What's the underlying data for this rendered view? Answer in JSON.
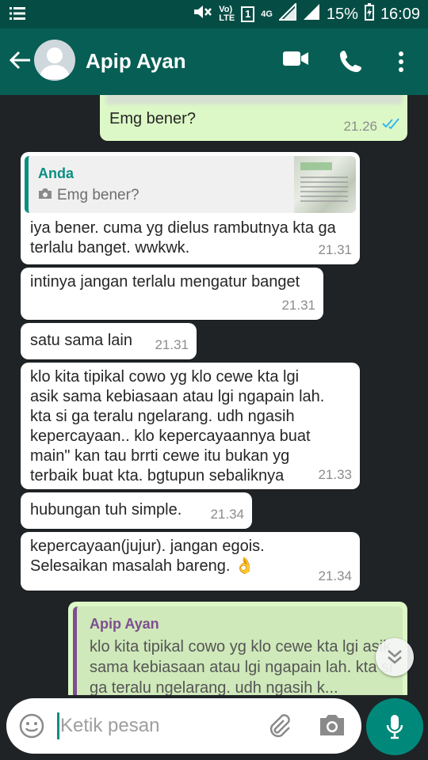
{
  "status_bar": {
    "volte_label": "Vo)\nLTE",
    "sim_label": "1",
    "network_label": "4G",
    "battery_percent": "15%",
    "time": "16:09"
  },
  "header": {
    "contact_name": "Apip Ayan"
  },
  "messages": [
    {
      "type": "out",
      "text": "Emg bener?",
      "time": "21.26",
      "status": "read"
    },
    {
      "type": "in",
      "quote_author": "Anda",
      "quote_text": "Emg bener?",
      "text": "iya bener. cuma yg dielus rambutnya kta ga\nterlalu banget. wwkwk.",
      "time": "21.31"
    },
    {
      "type": "in",
      "text": "intinya jangan terlalu mengatur banget",
      "time": "21.31"
    },
    {
      "type": "in",
      "text": "satu sama lain",
      "time": "21.31"
    },
    {
      "type": "in",
      "text": "klo kita tipikal cowo yg klo cewe kta lgi\nasik sama kebiasaan atau lgi ngapain lah.\nkta si ga teralu ngelarang. udh ngasih\nkepercayaan.. klo kepercayaannya buat\nmain\" kan tau brrti cewe itu bukan yg\nterbaik buat kta. bgtupun sebaliknya",
      "time": "21.33"
    },
    {
      "type": "in",
      "text": "hubungan tuh simple.",
      "time": "21.34"
    },
    {
      "type": "in",
      "text": "kepercayaan(jujur). jangan egois.\nSelesaikan masalah bareng.",
      "emoji": "👌",
      "time": "21.34"
    },
    {
      "type": "out",
      "quote_author": "Apip Ayan",
      "quote_text": "klo kita tipikal cowo yg klo cewe kta lgi asik sama kebiasaan atau lgi ngapain lah. kta si ga teralu ngelarang. udh ngasih k..."
    }
  ],
  "input": {
    "placeholder": "Ketik pesan"
  },
  "colors": {
    "status_bar": "#054d44",
    "header": "#075e54",
    "chat_background": "#1f2326",
    "outgoing_bubble": "#dcf8c6",
    "incoming_bubble": "#ffffff",
    "accent": "#00897b",
    "read_ticks": "#34b7f1"
  }
}
